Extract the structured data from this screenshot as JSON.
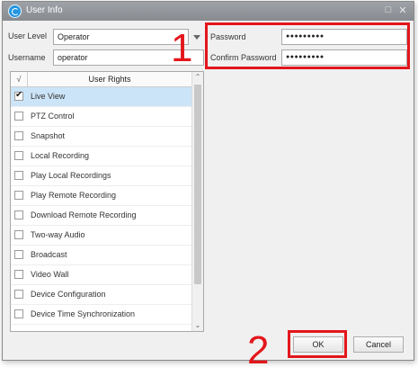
{
  "window": {
    "title": "User Info",
    "minimize_glyph": "□",
    "close_glyph": "✕"
  },
  "form": {
    "user_level_label": "User Level",
    "user_level_value": "Operator",
    "username_label": "Username",
    "username_value": "operator",
    "password_label": "Password",
    "password_value": "●●●●●●●●●",
    "confirm_label": "Confirm Password",
    "confirm_value": "●●●●●●●●●"
  },
  "rights": {
    "header_check": "√",
    "header_title": "User Rights",
    "items": [
      {
        "label": "Live View",
        "checked": true,
        "selected": true
      },
      {
        "label": "PTZ Control",
        "checked": false
      },
      {
        "label": "Snapshot",
        "checked": false
      },
      {
        "label": "Local Recording",
        "checked": false
      },
      {
        "label": "Play Local Recordings",
        "checked": false
      },
      {
        "label": "Play Remote Recording",
        "checked": false
      },
      {
        "label": "Download Remote Recording",
        "checked": false
      },
      {
        "label": "Two-way Audio",
        "checked": false
      },
      {
        "label": "Broadcast",
        "checked": false
      },
      {
        "label": "Video Wall",
        "checked": false
      },
      {
        "label": "Device Configuration",
        "checked": false
      },
      {
        "label": "Device Time Synchronization",
        "checked": false
      }
    ],
    "check_glyph": "✔",
    "scroll_up": "⌃",
    "scroll_down": "⌄"
  },
  "annotations": {
    "step1": "1",
    "step2": "2",
    "color": "#e3161b"
  },
  "buttons": {
    "ok": "OK",
    "cancel": "Cancel"
  },
  "icons": {
    "app": "app-logo-icon",
    "dropdown": "chevron-down-icon"
  }
}
